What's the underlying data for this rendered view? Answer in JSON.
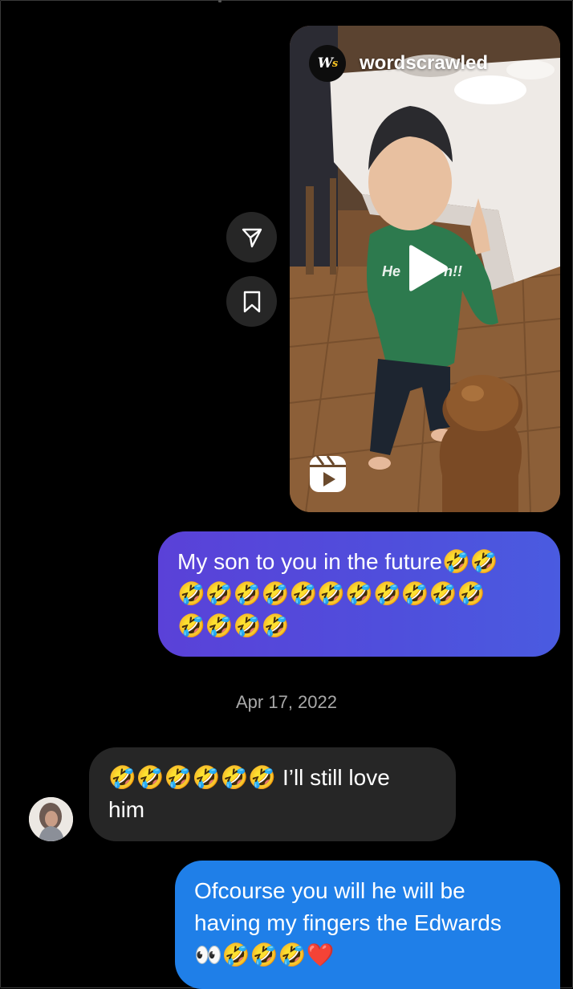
{
  "reel": {
    "username": "wordscrawled",
    "avatar_letter": "W",
    "avatar_letter_accent": "s",
    "play_icon": "play-icon",
    "reels_icon": "reels-icon"
  },
  "actions": {
    "share_icon": "send-icon",
    "save_icon": "bookmark-icon"
  },
  "messages": [
    {
      "direction": "outgoing",
      "text": "My son to you in the future🤣🤣\n🤣🤣🤣🤣🤣🤣🤣🤣🤣🤣🤣\n🤣🤣🤣🤣"
    },
    {
      "direction": "incoming",
      "text": "🤣🤣🤣🤣🤣🤣 I’ll still love\nhim"
    },
    {
      "direction": "outgoing",
      "text": "Ofcourse you will he will be\nhaving my fingers the Edwards\n👀🤣🤣🤣❤️"
    }
  ],
  "date_separator": "Apr 17, 2022",
  "colors": {
    "background": "#000000",
    "outgoing_purple": "#5549dc",
    "outgoing_blue": "#1f7fe8",
    "incoming_gray": "#262626",
    "timestamp": "#a8a8a8"
  }
}
